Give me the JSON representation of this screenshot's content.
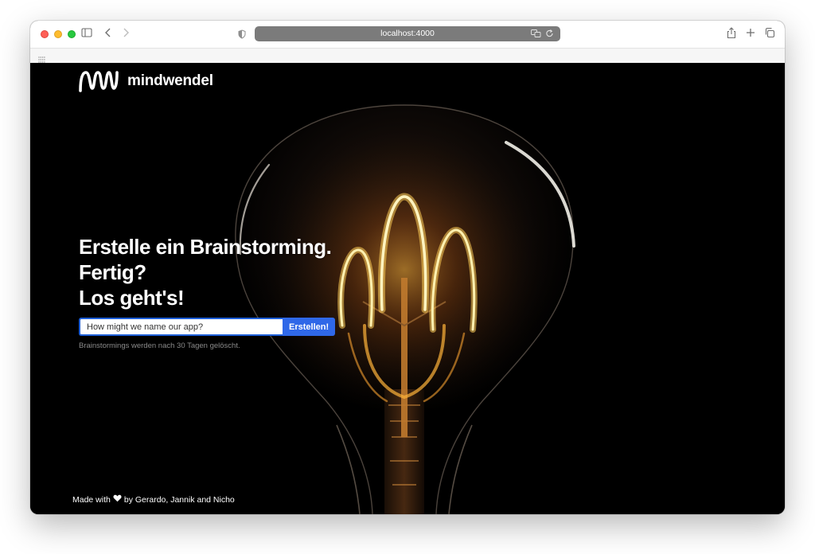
{
  "browser": {
    "url": "localhost:4000"
  },
  "app": {
    "brand": "mindwendel",
    "headline": [
      "Erstelle ein Brainstorming.",
      "Fertig?",
      "Los geht's!"
    ],
    "input_placeholder": "How might we name our app?",
    "submit_label": "Erstellen!",
    "hint": "Brainstormings werden nach 30 Tagen gelöscht.",
    "footer_prefix": "Made with",
    "footer_suffix": "by Gerardo, Jannik and Nicho"
  },
  "colors": {
    "accent": "#2f68e8",
    "background": "#000000",
    "urlbar": "#7b7b7b"
  },
  "icons": [
    "sidebar-icon",
    "back-icon",
    "forward-icon",
    "shield-icon",
    "translate-icon",
    "reload-icon",
    "share-icon",
    "new-tab-icon",
    "tabs-overview-icon",
    "grid-icon",
    "heart-icon"
  ]
}
